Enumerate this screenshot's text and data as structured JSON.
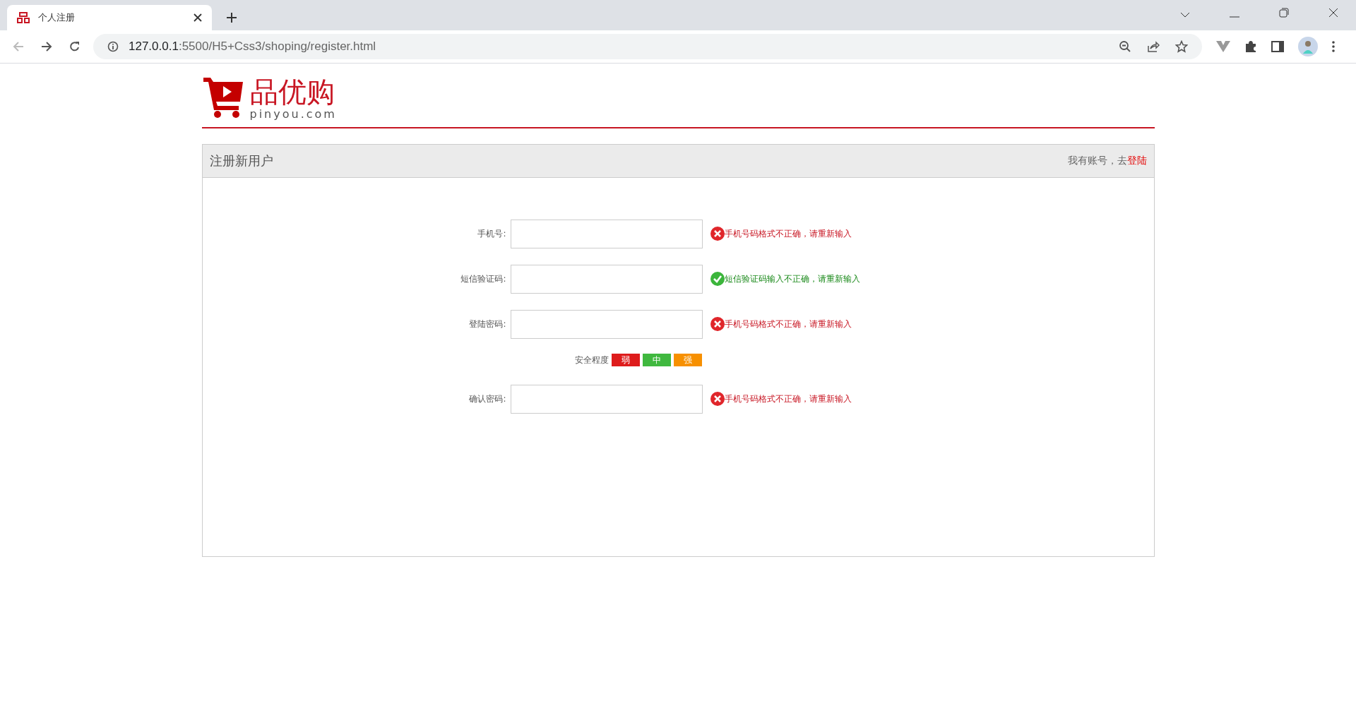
{
  "browser": {
    "tab": {
      "title": "个人注册"
    },
    "url": {
      "host": "127.0.0.1",
      "path": ":5500/H5+Css3/shoping/register.html"
    }
  },
  "logo": {
    "name": "品优购",
    "domain": "pinyou.com"
  },
  "panel": {
    "title": "注册新用户",
    "login_prompt": "我有账号，去",
    "login_link": "登陆"
  },
  "fields": [
    {
      "label": "手机号:",
      "message": {
        "kind": "error",
        "text": "手机号码格式不正确，请重新输入"
      }
    },
    {
      "label": "短信验证码:",
      "message": {
        "kind": "success",
        "text": "短信验证码输入不正确，请重新输入"
      }
    },
    {
      "label": "登陆密码:",
      "message": {
        "kind": "error",
        "text": "手机号码格式不正确，请重新输入"
      },
      "strength": {
        "label": "安全程度",
        "levels": [
          {
            "text": "弱",
            "color": "#de1c1c"
          },
          {
            "text": "中",
            "color": "#40b83f"
          },
          {
            "text": "强",
            "color": "#f79000"
          }
        ]
      }
    },
    {
      "label": "确认密码:",
      "message": {
        "kind": "error",
        "text": "手机号码格式不正确，请重新输入"
      }
    }
  ]
}
